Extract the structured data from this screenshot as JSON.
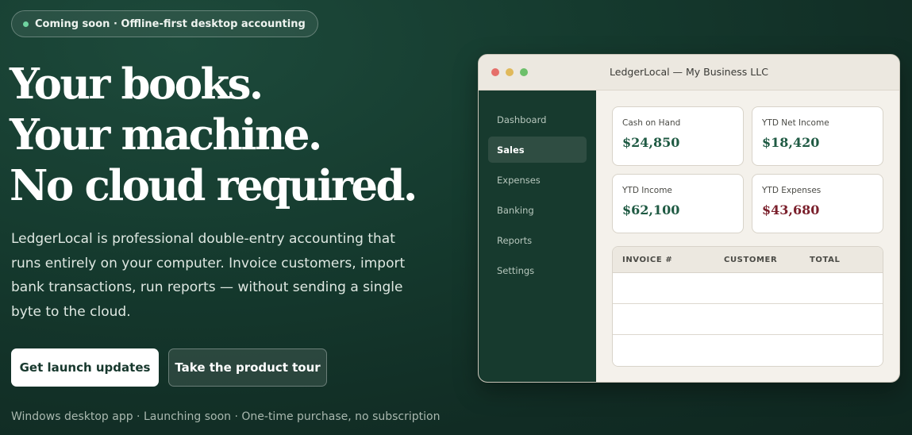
{
  "badge": {
    "text": "Coming soon · Offline-first desktop accounting"
  },
  "hero": {
    "headline_lines": [
      "Your books.",
      "Your machine.",
      "No cloud required."
    ],
    "description": "LedgerLocal is professional double-entry accounting that runs entirely on your computer. Invoice customers, import bank transactions, run reports — without sending a single byte to the cloud.",
    "primary_cta": "Get launch updates",
    "secondary_cta": "Take the product tour",
    "footnote": "Windows desktop app · Launching soon · One-time purchase, no subscription"
  },
  "app_window": {
    "title": "LedgerLocal — My Business LLC",
    "sidebar": {
      "items": [
        {
          "label": "Dashboard",
          "active": false
        },
        {
          "label": "Sales",
          "active": true
        },
        {
          "label": "Expenses",
          "active": false
        },
        {
          "label": "Banking",
          "active": false
        },
        {
          "label": "Reports",
          "active": false
        },
        {
          "label": "Settings",
          "active": false
        }
      ]
    },
    "stats": [
      {
        "label": "Cash on Hand",
        "value": "$24,850",
        "color": "#1f5a43"
      },
      {
        "label": "YTD Net Income",
        "value": "$18,420",
        "color": "#1f5a43"
      },
      {
        "label": "YTD Income",
        "value": "$62,100",
        "color": "#1f5a43"
      },
      {
        "label": "YTD Expenses",
        "value": "$43,680",
        "color": "#7a1f2b"
      }
    ],
    "invoice_table": {
      "columns": [
        "INVOICE #",
        "CUSTOMER",
        "TOTAL"
      ],
      "rows": [
        [],
        [],
        []
      ]
    }
  },
  "colors": {
    "background": "#153a2e",
    "accent_green": "#6fd3a0",
    "sidebar": "#173a2e",
    "positive_value": "#1f5a43",
    "negative_value": "#7a1f2b"
  }
}
